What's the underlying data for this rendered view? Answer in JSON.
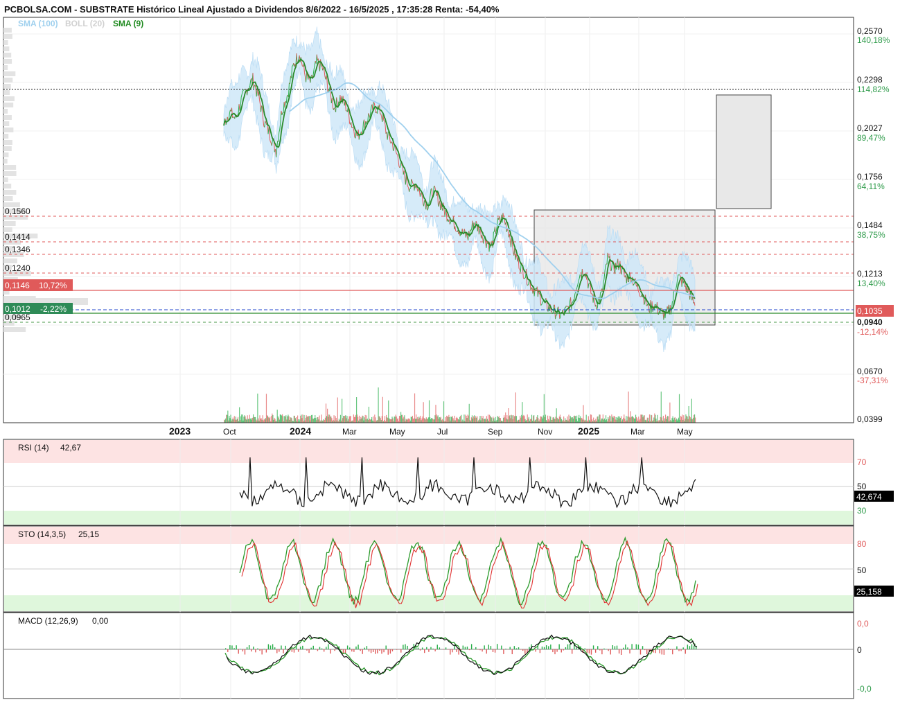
{
  "header": {
    "title": "PCBOLSA.COM - SUBSTRATE Histórico Lineal Ajustado a Dividendos 8/6/2022 - 16/5/2025 , 17:35:28 Renta: -54,40%",
    "legend": [
      {
        "label": "SMA (100)",
        "color": "#9fd0ee"
      },
      {
        "label": "BOLL (20)",
        "color": "#d0d0d0"
      },
      {
        "label": "SMA (9)",
        "color": "#1e8a1e"
      }
    ]
  },
  "colors": {
    "up": "#27ae48",
    "down": "#e05a5a",
    "price_line": "#e05a5a",
    "boll_fill": "#cfe7f8",
    "sma100": "#9fd0ee",
    "sma9": "#2a8a2a",
    "overbought": "#fde3e3",
    "oversold": "#dff7dc"
  },
  "chart_data": [
    {
      "type": "line",
      "name": "price",
      "x_labels": [
        "2023",
        "Oct",
        "2024",
        "Mar",
        "May",
        "Jul",
        "Sep",
        "Nov",
        "2025",
        "Mar",
        "May"
      ],
      "y_axis_ticks": [
        {
          "price": "0,2570",
          "pct": "140,18%"
        },
        {
          "price": "0,2298",
          "pct": "114,82%"
        },
        {
          "price": "0,2027",
          "pct": "89,47%"
        },
        {
          "price": "0,1756",
          "pct": "64,11%"
        },
        {
          "price": "0,1484",
          "pct": "38,75%"
        },
        {
          "price": "0,1213",
          "pct": "13,40%"
        },
        {
          "price": "0,0940",
          "pct": "-12,14%"
        },
        {
          "price": "0,0670",
          "pct": "-37,31%"
        },
        {
          "price": "0,0399",
          "pct": ""
        }
      ],
      "ylim": [
        0.0399,
        0.257
      ],
      "levels_left": [
        {
          "value": 0.156,
          "label": "0,1560"
        },
        {
          "value": 0.1414,
          "label": "0,1414"
        },
        {
          "value": 0.1346,
          "label": "0,1346"
        },
        {
          "value": 0.124,
          "label": "0,1240"
        },
        {
          "value": 0.0965,
          "label": "0,0965"
        }
      ],
      "marker_high": {
        "value": 0.1146,
        "label": "0,1146",
        "pct": "10,72%"
      },
      "marker_low": {
        "value": 0.1012,
        "label": "0,1012",
        "pct": "-2,22%"
      },
      "last_price": {
        "value": 0.1035,
        "label": "0,1035"
      },
      "reference_line": 0.2298,
      "series": [
        {
          "name": "Close",
          "values": [
            0.205,
            0.212,
            0.208,
            0.218,
            0.225,
            0.23,
            0.22,
            0.206,
            0.199,
            0.19,
            0.213,
            0.222,
            0.238,
            0.245,
            0.232,
            0.228,
            0.24,
            0.236,
            0.225,
            0.214,
            0.22,
            0.215,
            0.205,
            0.198,
            0.204,
            0.21,
            0.215,
            0.212,
            0.2,
            0.194,
            0.186,
            0.176,
            0.17,
            0.172,
            0.165,
            0.16,
            0.168,
            0.162,
            0.156,
            0.152,
            0.148,
            0.144,
            0.142,
            0.15,
            0.146,
            0.14,
            0.136,
            0.149,
            0.153,
            0.145,
            0.132,
            0.126,
            0.12,
            0.114,
            0.11,
            0.105,
            0.102,
            0.1,
            0.098,
            0.101,
            0.106,
            0.12,
            0.124,
            0.112,
            0.104,
            0.11,
            0.13,
            0.124,
            0.127,
            0.119,
            0.12,
            0.114,
            0.11,
            0.102,
            0.104,
            0.1,
            0.098,
            0.103,
            0.12,
            0.116,
            0.111,
            0.1035
          ]
        }
      ]
    },
    {
      "type": "line",
      "name": "RSI (14)",
      "label": "RSI (14)",
      "label_value": "42,67",
      "last_value": "42,674",
      "levels": [
        "70",
        "50",
        "30"
      ],
      "ylim": [
        20,
        80
      ]
    },
    {
      "type": "line",
      "name": "STO (14,3,5)",
      "label": "STO (14,3,5)",
      "label_value": "25,15",
      "last_value": "25,158",
      "levels": [
        "80",
        "50",
        "20"
      ],
      "ylim": [
        0,
        100
      ]
    },
    {
      "type": "line",
      "name": "MACD (12,26,9)",
      "label": "MACD (12,26,9)",
      "label_value": "0,00",
      "levels": [
        "0,0",
        "0",
        "-0,0"
      ]
    }
  ]
}
